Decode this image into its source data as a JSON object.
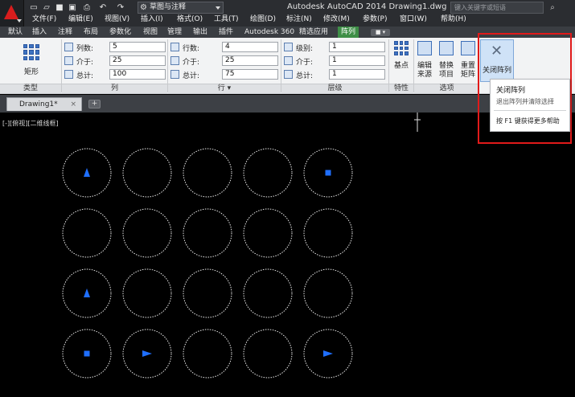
{
  "titlebar": {
    "app_title": "Autodesk AutoCAD 2014    Drawing1.dwg",
    "workspace": "草图与注释",
    "search_placeholder": "键入关键字或短语",
    "qat_icons": [
      "new-file-icon",
      "open-file-icon",
      "save-icon",
      "save-as-icon",
      "print-icon",
      "undo-icon",
      "redo-icon"
    ]
  },
  "menubar": {
    "items": [
      "文件(F)",
      "编辑(E)",
      "视图(V)",
      "插入(I)",
      "格式(O)",
      "工具(T)",
      "绘图(D)",
      "标注(N)",
      "修改(M)",
      "参数(P)",
      "窗口(W)",
      "帮助(H)"
    ]
  },
  "ribbon_tabs": {
    "items": [
      "默认",
      "插入",
      "注释",
      "布局",
      "参数化",
      "视图",
      "管理",
      "输出",
      "插件",
      "Autodesk 360",
      "精选应用",
      "阵列"
    ],
    "active": "阵列"
  },
  "ribbon": {
    "type_panel": {
      "button": "矩形",
      "footer": "类型"
    },
    "column_panel": {
      "footer": "列",
      "fields": [
        {
          "label": "列数:",
          "value": "5"
        },
        {
          "label": "介于:",
          "value": "25"
        },
        {
          "label": "总计:",
          "value": "100"
        }
      ]
    },
    "row_panel": {
      "footer": "行 ▾",
      "fields": [
        {
          "label": "行数:",
          "value": "4"
        },
        {
          "label": "介于:",
          "value": "25"
        },
        {
          "label": "总计:",
          "value": "75"
        }
      ]
    },
    "level_panel": {
      "footer": "层级",
      "fields": [
        {
          "label": "级别:",
          "value": "1"
        },
        {
          "label": "介于:",
          "value": "1"
        },
        {
          "label": "总计:",
          "value": "1"
        }
      ]
    },
    "property_panel": {
      "button": "基点",
      "footer": "特性"
    },
    "options_panel": {
      "footer": "选项",
      "buttons": [
        {
          "line1": "编辑",
          "line2": "来源"
        },
        {
          "line1": "替换",
          "line2": "项目"
        },
        {
          "line1": "重置",
          "line2": "矩阵"
        }
      ]
    },
    "close_panel": {
      "button": "关闭阵列"
    }
  },
  "tooltip": {
    "title": "关闭阵列",
    "description": "退出阵列并清除选择",
    "help": "按 F1 键获得更多帮助"
  },
  "document": {
    "tab": "Drawing1*",
    "close": "×",
    "new_tab": "+"
  },
  "canvas": {
    "viewport_label": "[-][俯视][二维线框]",
    "grid": {
      "columns": 5,
      "rows": 4
    },
    "symbols": [
      {
        "row": 0,
        "col": 0,
        "shape": "triangle-up"
      },
      {
        "row": 0,
        "col": 4,
        "shape": "square"
      },
      {
        "row": 2,
        "col": 0,
        "shape": "triangle-up"
      },
      {
        "row": 3,
        "col": 0,
        "shape": "square"
      },
      {
        "row": 3,
        "col": 1,
        "shape": "triangle-right"
      },
      {
        "row": 3,
        "col": 4,
        "shape": "triangle-right"
      }
    ],
    "colors": {
      "circle": "#e8e8e8",
      "symbol": "#1f6fff",
      "background": "#000000"
    }
  },
  "colors": {
    "active_tab": "#3e8e47",
    "highlight": "#e11a1a",
    "title_bg": "#2b2d31"
  }
}
